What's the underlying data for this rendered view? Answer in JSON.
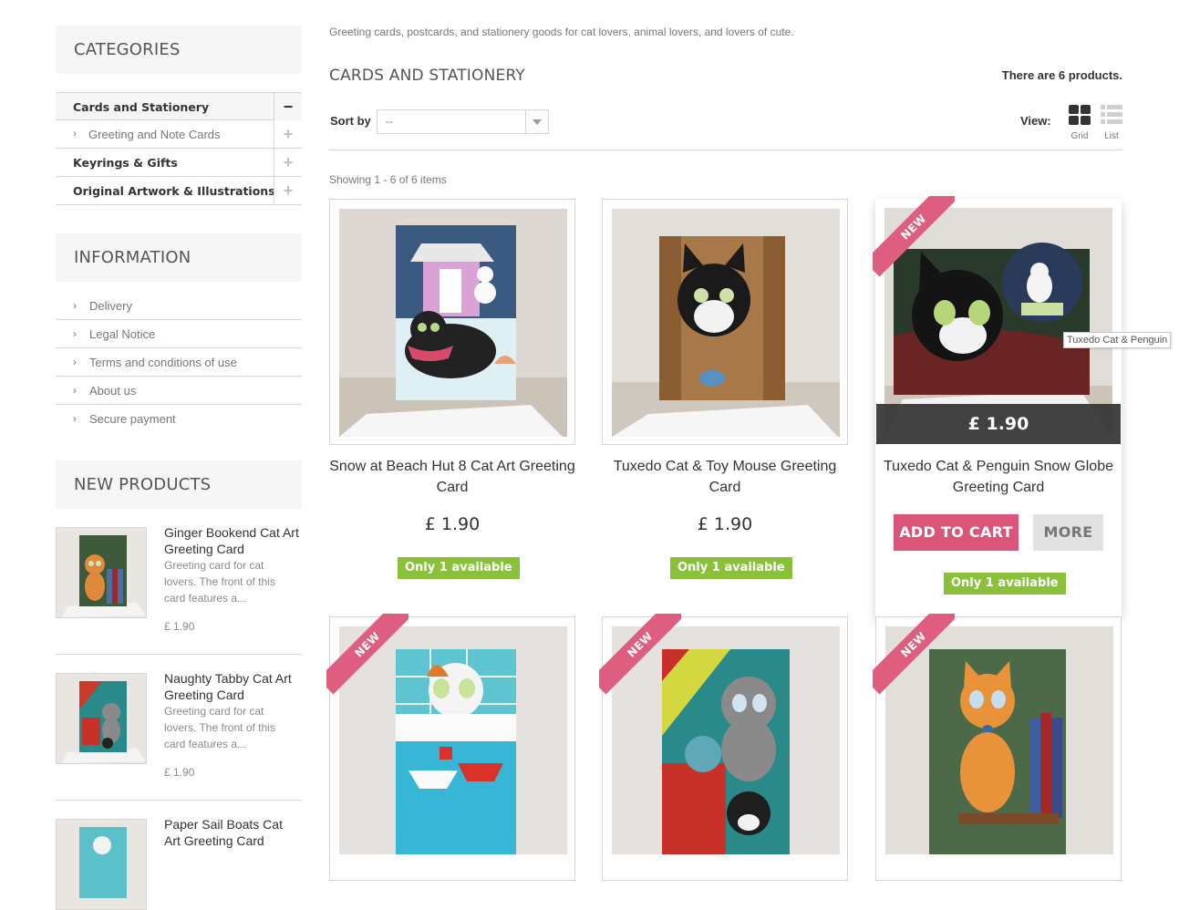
{
  "sidebar": {
    "categories_title": "CATEGORIES",
    "categories": [
      {
        "label": "Cards and Stationery",
        "toggle": "−"
      },
      {
        "label": "Greeting and Note Cards",
        "toggle": "+"
      },
      {
        "label": "Keyrings & Gifts",
        "toggle": "+"
      },
      {
        "label": "Original Artwork & Illustrations",
        "toggle": "+"
      }
    ],
    "information_title": "INFORMATION",
    "information": [
      "Delivery",
      "Legal Notice",
      "Terms and conditions of use",
      "About us",
      "Secure payment"
    ],
    "new_products_title": "NEW PRODUCTS",
    "new_products": [
      {
        "name": "Ginger Bookend Cat Art Greeting Card",
        "desc": "Greeting card for cat lovers. The front of this card features a...",
        "price": "£ 1.90"
      },
      {
        "name": "Naughty Tabby Cat Art Greeting Card",
        "desc": "Greeting card for cat lovers. The front of this card features a...",
        "price": "£ 1.90"
      },
      {
        "name": "Paper Sail Boats Cat Art Greeting Card"
      }
    ]
  },
  "main": {
    "intro": "Greeting cards, postcards, and stationery goods for cat lovers, animal lovers, and lovers of cute.",
    "title": "CARDS AND STATIONERY",
    "count": "There are 6 products.",
    "sort_label": "Sort by",
    "sort_value": "--",
    "view_label": "View:",
    "view_grid": "Grid",
    "view_list": "List",
    "showing": "Showing 1 - 6 of 6 items",
    "products": [
      {
        "name": "Snow at Beach Hut 8 Cat Art Greeting Card",
        "price": "£ 1.90",
        "availability": "Only 1 available"
      },
      {
        "name": "Tuxedo Cat & Toy Mouse Greeting Card",
        "price": "£ 1.90",
        "availability": "Only 1 available"
      },
      {
        "name": "Tuxedo Cat & Penguin Snow Globe Greeting Card",
        "price": "£ 1.90",
        "availability": "Only 1 available",
        "badge": "NEW",
        "add_to_cart": "ADD TO CART",
        "more": "MORE",
        "tooltip": "Tuxedo Cat & Penguin"
      },
      {
        "badge": "NEW"
      },
      {
        "badge": "NEW"
      },
      {
        "badge": "NEW"
      }
    ]
  },
  "colors": {
    "accent": "#d9567a",
    "available": "#8bc13a",
    "panel": "#f6f6f6"
  }
}
